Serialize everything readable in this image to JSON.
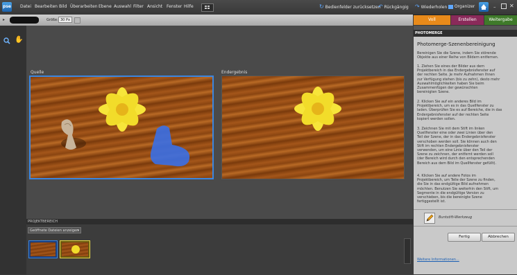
{
  "app": {
    "logo": "pse"
  },
  "menu": [
    "Datei",
    "Bearbeiten",
    "Bild",
    "Überarbeiten",
    "Ebene",
    "Auswahl",
    "Filter",
    "Ansicht",
    "Fenster",
    "Hilfe"
  ],
  "toolbar": {
    "reset": "Bedienfelder zurücksetzen",
    "undo": "Rückgängig",
    "redo": "Wiederholen",
    "organizer": "Organizer"
  },
  "options": {
    "size_label": "Größe:",
    "size_value": "30 Px"
  },
  "tabs": [
    "Voll",
    "Erstellen",
    "Weitergabe"
  ],
  "canvas": {
    "source_label": "Quelle",
    "result_label": "Endergebnis"
  },
  "project": {
    "header": "PROJEKTBEREICH",
    "filter": "Geöffnete Dateien anzeigen"
  },
  "panel": {
    "tab": "PHOTOMERGE",
    "title": "Photomerge-Szenenbereinigung",
    "intro": [
      "Bereinigen Sie die Szene, indem Sie störende",
      "Objekte aus einer Reihe von Bildern entfernen."
    ],
    "step1": [
      "1. Ziehen Sie eines der Bilder aus dem",
      "Projektbereich in das Endergebnisfenster auf",
      "der rechten Seite. Je mehr Aufnahmen Ihnen",
      "zur Verfügung stehen (bis zu zehn), desto mehr",
      "Auswahlmöglichkeiten haben Sie beim",
      "Zusammenfügen der gewünschten",
      "bereinigten Szene."
    ],
    "step2": [
      "2. Klicken Sie auf ein anderes Bild im",
      "Projektbereich, um es in das Quellfenster zu",
      "laden. Überprüfen Sie es auf Bereiche, die in das",
      "Endergebnisfenster auf der rechten Seite",
      "kopiert werden sollen."
    ],
    "step3": [
      "3. Zeichnen Sie mit dem Stift im linken",
      "Quellfenster eine oder zwei Linien über den",
      "Teil der Szene, der in das Endergebnisfenster",
      "verschoben werden soll. Sie können auch den",
      "Stift im rechten Endergebnisfenster",
      "verwenden, um eine Linie über den Teil der",
      "Szene zu zeichnen, der entfernt werden soll",
      "(der Bereich wird durch den entsprechenden",
      "Bereich aus dem Bild im Quellfenster gefüllt)."
    ],
    "step4": [
      "4. Klicken Sie auf andere Fotos im",
      "Projektbereich, um Teile der Szene zu finden,",
      "die Sie in das endgültige Bild aufnehmen",
      "möchten. Benutzen Sie weiterhin den Stift, um",
      "Segmente in die endgültige Version zu",
      "verschieben, bis die bereinigte Szene",
      "fertiggestellt ist."
    ],
    "tool": "Buntstift-Werkzeug",
    "ok": "Fertig",
    "cancel": "Abbrechen",
    "more": "Weitere Informationen..."
  },
  "colors": {
    "accent": "#3b86e0",
    "tab_voll": "#e88a1a",
    "tab_erstellen": "#8a2a5a",
    "tab_weitergabe": "#3f7a2a"
  }
}
